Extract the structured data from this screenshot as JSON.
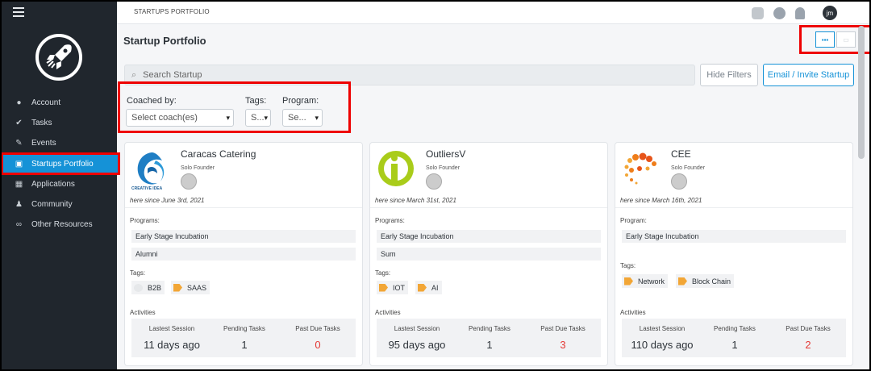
{
  "header": {
    "breadcrumb": "STARTUPS PORTFOLIO",
    "avatar_initials": "jm"
  },
  "sidebar": {
    "items": [
      {
        "label": "Account",
        "icon": "user-icon"
      },
      {
        "label": "Tasks",
        "icon": "check-circle-icon"
      },
      {
        "label": "Events",
        "icon": "megaphone-icon"
      },
      {
        "label": "Startups Portfolio",
        "icon": "portfolio-icon",
        "active": true
      },
      {
        "label": "Applications",
        "icon": "applications-icon"
      },
      {
        "label": "Community",
        "icon": "community-icon"
      },
      {
        "label": "Other Resources",
        "icon": "link-icon"
      }
    ]
  },
  "page": {
    "title": "Startup Portfolio",
    "search_placeholder": "Search Startup",
    "hide_filters": "Hide Filters",
    "email_invite": "Email / Invite Startup",
    "filters": {
      "coached_label": "Coached by:",
      "coached_value": "Select coach(es)",
      "tags_label": "Tags:",
      "tags_value": "S...",
      "program_label": "Program:",
      "program_value": "Se..."
    }
  },
  "cards": [
    {
      "name": "Caracas Catering",
      "founder": "Solo Founder",
      "since": "here since June 3rd, 2021",
      "programs_label": "Programs:",
      "programs": [
        "Early Stage Incubation",
        "Alumni"
      ],
      "tags_label": "Tags:",
      "tags": [
        "B2B",
        "SAAS"
      ],
      "activities_label": "Activities",
      "act_labels": [
        "Lastest Session",
        "Pending Tasks",
        "Past Due Tasks"
      ],
      "act_values": [
        "11 days ago",
        "1",
        "0"
      ]
    },
    {
      "name": "OutliersV",
      "founder": "Solo Founder",
      "since": "here since March 31st, 2021",
      "programs_label": "Programs:",
      "programs": [
        "Early Stage Incubation",
        "Sum"
      ],
      "tags_label": "Tags:",
      "tags": [
        "IOT",
        "AI"
      ],
      "activities_label": "Activities",
      "act_labels": [
        "Lastest Session",
        "Pending Tasks",
        "Past Due Tasks"
      ],
      "act_values": [
        "95 days ago",
        "1",
        "3"
      ]
    },
    {
      "name": "CEE",
      "founder": "Solo Founder",
      "since": "here since March 16th, 2021",
      "programs_label": "Program:",
      "programs": [
        "Early Stage Incubation"
      ],
      "tags_label": "Tags:",
      "tags": [
        "Network",
        "Block Chain"
      ],
      "activities_label": "Activities",
      "act_labels": [
        "Lastest Session",
        "Pending Tasks",
        "Past Due Tasks"
      ],
      "act_values": [
        "110 days ago",
        "1",
        "2"
      ]
    }
  ],
  "logo_text": "CREATIVE IDEA"
}
